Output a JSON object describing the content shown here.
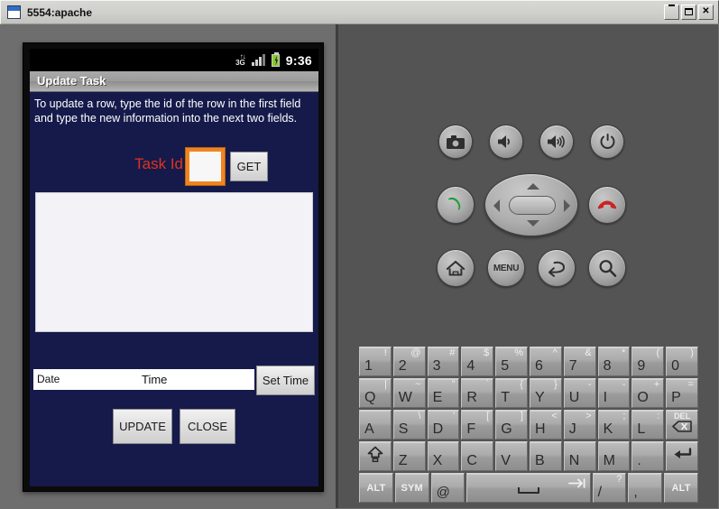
{
  "window": {
    "title": "5554:apache",
    "icon": "window-icon",
    "buttons": [
      {
        "name": "minimize-button",
        "label": "_"
      },
      {
        "name": "maximize-button",
        "label": "□"
      },
      {
        "name": "close-button",
        "label": "✕"
      }
    ]
  },
  "device": {
    "statusbar": {
      "network_up": "↑↓",
      "network": "3G",
      "clock": "9:36",
      "icons": [
        "3g-icon",
        "signal-icon",
        "battery-charging-icon"
      ]
    },
    "app": {
      "title": "Update Task",
      "instructions": "To update a row, type the id of the row in the first field and type the new information into the next two fields.",
      "id_label": "Task Id",
      "id_value": "",
      "get_label": "GET",
      "notes_value": "",
      "date_label": "Date",
      "time_label": "Time",
      "set_time_label": "Set Time",
      "update_label": "UPDATE",
      "close_label": "CLOSE"
    }
  },
  "colors": {
    "app_background": "#151a4a",
    "focus_orange": "#f08421",
    "label_red": "#e0331e",
    "panel_left": "#6e6e6e",
    "panel_right": "#545454",
    "battery_green": "#8bc832",
    "call_green": "#1f9d3a",
    "endcall_red": "#cc2222"
  },
  "controls": {
    "row1": [
      {
        "name": "camera-button",
        "icon": "camera-icon"
      },
      {
        "name": "volume-down-button",
        "icon": "volume-down-icon"
      },
      {
        "name": "volume-up-button",
        "icon": "volume-up-icon"
      },
      {
        "name": "power-button",
        "icon": "power-icon"
      }
    ],
    "call_button": {
      "name": "call-button",
      "icon": "call-icon"
    },
    "endcall_button": {
      "name": "end-call-button",
      "icon": "end-call-icon"
    },
    "dpad": {
      "name": "dpad",
      "center": "dpad-center-button"
    },
    "row3": [
      {
        "name": "home-button",
        "icon": "home-icon",
        "label": ""
      },
      {
        "name": "menu-button",
        "icon": "menu-icon",
        "label": "MENU"
      },
      {
        "name": "back-button",
        "icon": "back-icon",
        "label": ""
      },
      {
        "name": "search-button",
        "icon": "search-icon",
        "label": ""
      }
    ]
  },
  "keyboard": {
    "rows": [
      [
        {
          "main": "1",
          "alt": "!"
        },
        {
          "main": "2",
          "alt": "@"
        },
        {
          "main": "3",
          "alt": "#"
        },
        {
          "main": "4",
          "alt": "$"
        },
        {
          "main": "5",
          "alt": "%"
        },
        {
          "main": "6",
          "alt": "^"
        },
        {
          "main": "7",
          "alt": "&"
        },
        {
          "main": "8",
          "alt": "*"
        },
        {
          "main": "9",
          "alt": "("
        },
        {
          "main": "0",
          "alt": ")"
        }
      ],
      [
        {
          "main": "Q",
          "alt": "|"
        },
        {
          "main": "W",
          "alt": "~"
        },
        {
          "main": "E",
          "alt": "”"
        },
        {
          "main": "R",
          "alt": "`"
        },
        {
          "main": "T",
          "alt": "{"
        },
        {
          "main": "Y",
          "alt": "}"
        },
        {
          "main": "U",
          "alt": "-"
        },
        {
          "main": "I",
          "alt": "-"
        },
        {
          "main": "O",
          "alt": "+"
        },
        {
          "main": "P",
          "alt": "="
        }
      ],
      [
        {
          "main": "A",
          "alt": ""
        },
        {
          "main": "S",
          "alt": "\\"
        },
        {
          "main": "D",
          "alt": "’"
        },
        {
          "main": "F",
          "alt": "["
        },
        {
          "main": "G",
          "alt": "]"
        },
        {
          "main": "H",
          "alt": "<"
        },
        {
          "main": "J",
          "alt": ">"
        },
        {
          "main": "K",
          "alt": ";"
        },
        {
          "main": "L",
          "alt": ":"
        },
        {
          "main": "DEL",
          "alt": "",
          "icon": "delete-icon"
        }
      ],
      [
        {
          "main": "",
          "alt": "",
          "icon": "shift-icon"
        },
        {
          "main": "Z",
          "alt": ""
        },
        {
          "main": "X",
          "alt": ""
        },
        {
          "main": "C",
          "alt": ""
        },
        {
          "main": "V",
          "alt": ""
        },
        {
          "main": "B",
          "alt": ""
        },
        {
          "main": "N",
          "alt": ""
        },
        {
          "main": "M",
          "alt": ""
        },
        {
          "main": ".",
          "alt": ""
        },
        {
          "main": "",
          "alt": "",
          "icon": "enter-icon"
        }
      ],
      [
        {
          "main": "ALT",
          "alt": ""
        },
        {
          "main": "SYM",
          "alt": ""
        },
        {
          "main": "@",
          "alt": ""
        },
        {
          "main": "",
          "alt": "",
          "icon": "space-tab-icon"
        },
        {
          "main": "/",
          "alt": "?"
        },
        {
          "main": ",",
          "alt": ""
        },
        {
          "main": "ALT",
          "alt": ""
        }
      ]
    ]
  }
}
